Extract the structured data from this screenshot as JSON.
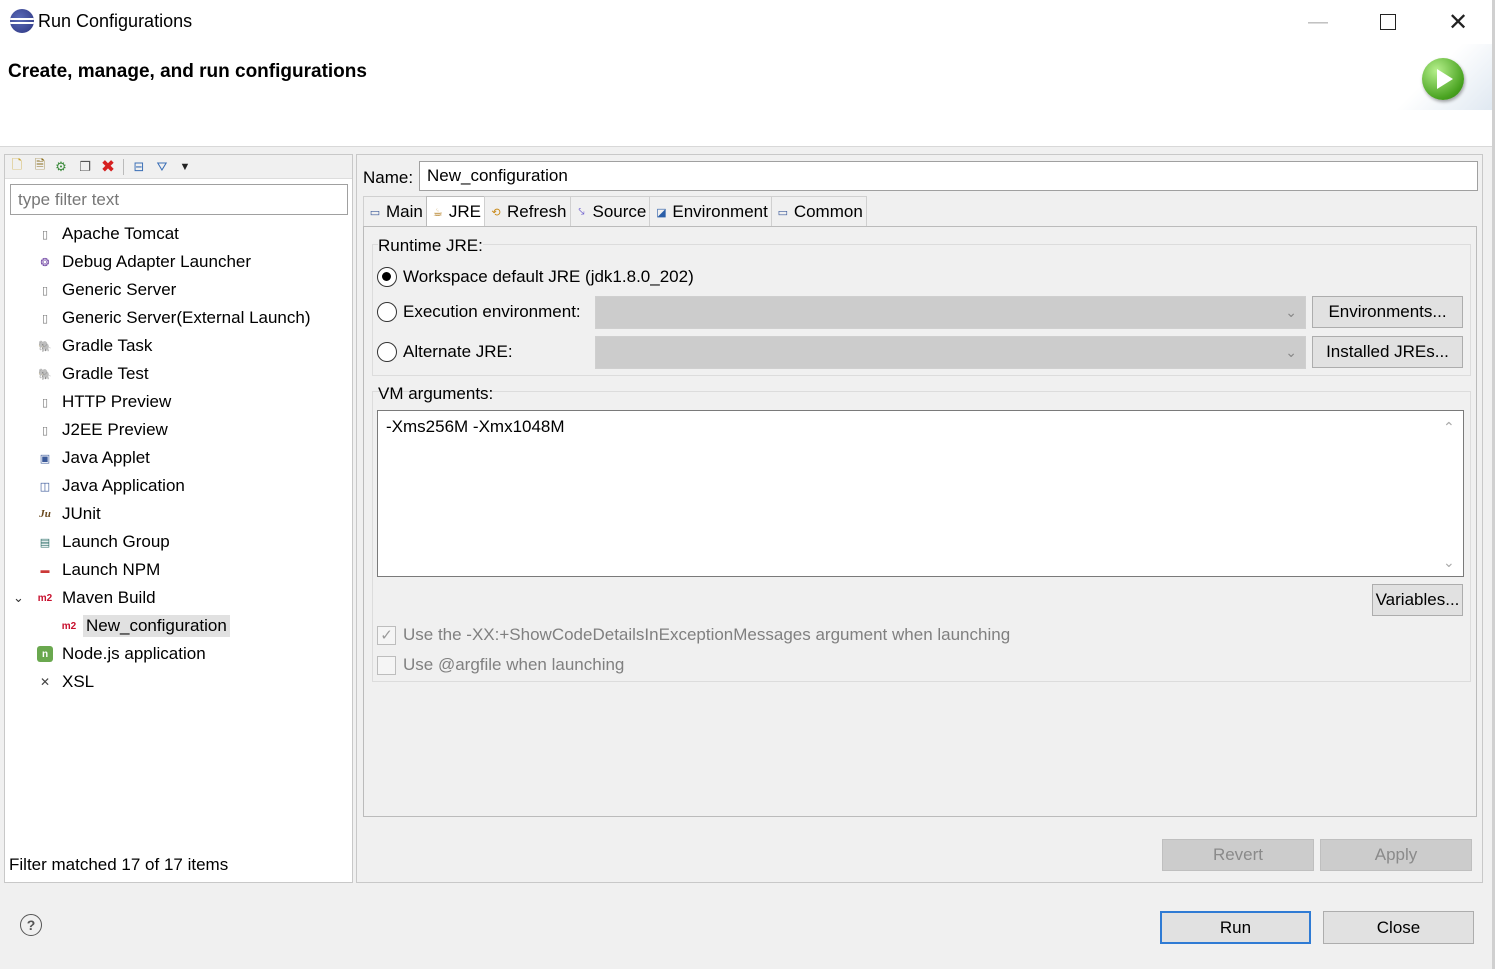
{
  "window": {
    "title": "Run Configurations",
    "minimize": "—",
    "close": "✕"
  },
  "header": {
    "title": "Create, manage, and run configurations"
  },
  "left": {
    "filter_placeholder": "type filter text",
    "tree": [
      {
        "label": "Apache Tomcat",
        "icon": "server-icon"
      },
      {
        "label": "Debug Adapter Launcher",
        "icon": "debug-adapter-icon"
      },
      {
        "label": "Generic Server",
        "icon": "server-icon"
      },
      {
        "label": "Generic Server(External Launch)",
        "icon": "server-icon"
      },
      {
        "label": "Gradle Task",
        "icon": "gradle-icon"
      },
      {
        "label": "Gradle Test",
        "icon": "gradle-icon"
      },
      {
        "label": "HTTP Preview",
        "icon": "server-icon"
      },
      {
        "label": "J2EE Preview",
        "icon": "server-icon"
      },
      {
        "label": "Java Applet",
        "icon": "java-applet-icon"
      },
      {
        "label": "Java Application",
        "icon": "java-app-icon"
      },
      {
        "label": "JUnit",
        "icon": "junit-icon",
        "glyph": "Ju"
      },
      {
        "label": "Launch Group",
        "icon": "launch-group-icon"
      },
      {
        "label": "Launch NPM",
        "icon": "npm-icon"
      },
      {
        "label": "Maven Build",
        "icon": "maven-icon",
        "glyph": "m2"
      },
      {
        "label": "New_configuration",
        "icon": "maven-icon",
        "glyph": "m2"
      },
      {
        "label": "Node.js application",
        "icon": "nodejs-icon",
        "glyph": "n"
      },
      {
        "label": "XSL",
        "icon": "xsl-icon",
        "glyph": "✕"
      }
    ],
    "status": "Filter matched 17 of 17 items"
  },
  "right": {
    "name_label": "Name:",
    "name_value": "New_configuration",
    "tabs": [
      {
        "label": "Main"
      },
      {
        "label": "JRE"
      },
      {
        "label": "Refresh"
      },
      {
        "label": "Source"
      },
      {
        "label": "Environment"
      },
      {
        "label": "Common"
      }
    ],
    "active_tab": "JRE",
    "jre": {
      "group_label": "Runtime JRE:",
      "workspace_default": "Workspace default JRE (jdk1.8.0_202)",
      "execution_env": "Execution environment:",
      "alternate": "Alternate JRE:",
      "environments_button": "Environments...",
      "installed_button": "Installed JREs..."
    },
    "vm": {
      "group_label": "VM arguments:",
      "value": "-Xms256M -Xmx1048M",
      "variables_button": "Variables..."
    },
    "checks": {
      "show_code_details": "Use the -XX:+ShowCodeDetailsInExceptionMessages argument when launching",
      "argfile": "Use @argfile when launching"
    },
    "revert_button": "Revert",
    "apply_button": "Apply"
  },
  "footer": {
    "help": "?",
    "run_button": "Run",
    "close_button": "Close"
  },
  "colors": {
    "accent": "#2f7bd4",
    "run_green": "#48a21f",
    "maven_red": "#c8102e"
  }
}
